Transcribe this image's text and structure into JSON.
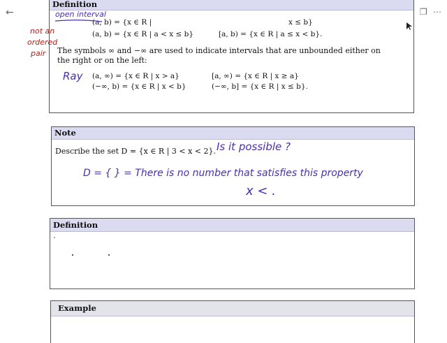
{
  "nav": {
    "back_icon": "arrow-left-icon"
  },
  "toolbar": {
    "tools": [
      "pen-icon",
      "pencil-icon",
      "highlighter-icon",
      "eraser-icon",
      "lasso-icon",
      "shape-icon",
      "add-icon",
      "mic-icon",
      "sticker-icon",
      "chevron-right-icon"
    ],
    "colors": [
      "#3a4fa8",
      "#e53935",
      "#1e88e5",
      "#f9a825",
      "#d81b9b",
      "#1565c0",
      "#2e7d32",
      "#26a69a"
    ],
    "selected_color": "#3a4fa8"
  },
  "right_tools": [
    "undo-icon",
    "redo-icon",
    "copy-icon",
    "duplicate-icon",
    "more-icon"
  ],
  "card1": {
    "heading": "Definition",
    "line1a": "(a, b) = {x ∈ R |",
    "line1b": "x ≤ b}",
    "line2a": "(a, b) = {x ∈ R | a < x ≤ b}",
    "line2b": "[a, b) = {x ∈ R | a ≤ x < b}.",
    "para1": "The symbols ∞ and −∞ are used to indicate intervals that are unbounded either on",
    "para2": "the right or on the left:",
    "ray1a": "(a, ∞) = {x ∈ R | x > a}",
    "ray1b": "[a, ∞)   = {x ∈ R | x ≥ a}",
    "ray2a": "(−∞, b) = {x ∈ R | x < b}",
    "ray2b": "(−∞, b] = {x ∈ R | x ≤ b}."
  },
  "notes_card1": {
    "open_interval": "open interval",
    "ray": "Ray",
    "margin1": "not an",
    "margin2": "ordered",
    "margin3": "pair"
  },
  "card2": {
    "heading": "Note",
    "body": "Describe the set D = {x ∈ R | 3 < x < 2}."
  },
  "notes_card2": {
    "question": "Is it possible ?",
    "answer": "D = { }  =  There is no number that satisfies this property",
    "formula": "x < ."
  },
  "card3": {
    "heading": "Definition"
  },
  "card4": {
    "heading": "Example"
  }
}
